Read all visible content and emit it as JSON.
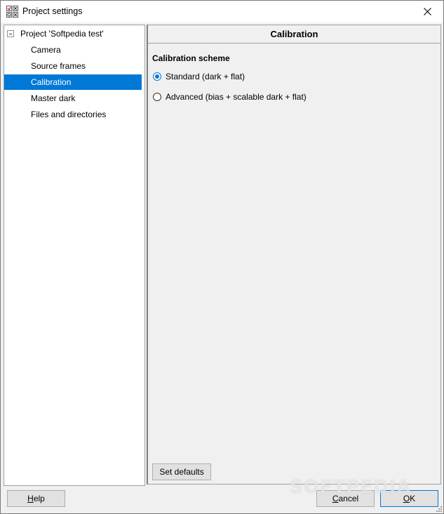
{
  "window": {
    "title": "Project settings"
  },
  "tree": {
    "root": {
      "label": "Project 'Softpedia test'",
      "expanded": true
    },
    "items": [
      {
        "label": "Camera",
        "selected": false
      },
      {
        "label": "Source frames",
        "selected": false
      },
      {
        "label": "Calibration",
        "selected": true
      },
      {
        "label": "Master dark",
        "selected": false
      },
      {
        "label": "Files and directories",
        "selected": false
      }
    ]
  },
  "panel": {
    "header": "Calibration",
    "section_label": "Calibration scheme",
    "options": [
      {
        "label": "Standard (dark + flat)",
        "checked": true
      },
      {
        "label": "Advanced (bias + scalable dark + flat)",
        "checked": false
      }
    ],
    "set_defaults_label": "Set defaults"
  },
  "buttons": {
    "help": {
      "mnemonic": "H",
      "rest": "elp"
    },
    "cancel": {
      "mnemonic": "C",
      "rest": "ancel"
    },
    "ok": {
      "mnemonic": "O",
      "rest": "K"
    }
  },
  "watermark": "SOFTPEDIA",
  "colors": {
    "selection": "#0078d7",
    "background": "#f0f0f0"
  }
}
